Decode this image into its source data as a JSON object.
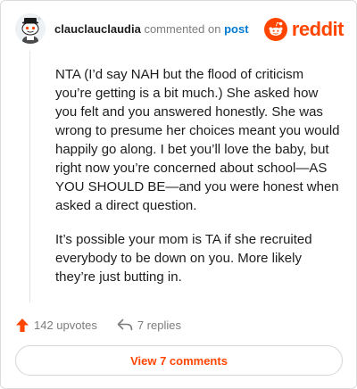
{
  "comment": {
    "username": "clauclauclaudia",
    "action_text": "commented on",
    "post_link": "post",
    "paragraphs": [
      "NTA (I’d say NAH but the flood of criticism you’re getting is a bit much.) She asked how you felt and you answered honestly. She was wrong to presume her choices meant you would happily go along. I bet you’ll love the baby, but right now you’re concerned about school—AS YOU SHOULD BE—and you were honest when asked a direct question.",
      "It’s possible your mom is TA if she recruited everybody to be down on you. More likely they’re just butting in."
    ]
  },
  "brand": {
    "wordmark": "reddit",
    "color": "#ff4500",
    "logo_icon": "reddit-snoo-icon"
  },
  "actions": {
    "upvotes": "142 upvotes",
    "upvote_icon": "upvote-arrow-icon",
    "upvote_color": "#ff4500",
    "replies": "7 replies",
    "reply_icon": "reply-arrow-icon"
  },
  "view_button": {
    "label": "View 7 comments"
  }
}
